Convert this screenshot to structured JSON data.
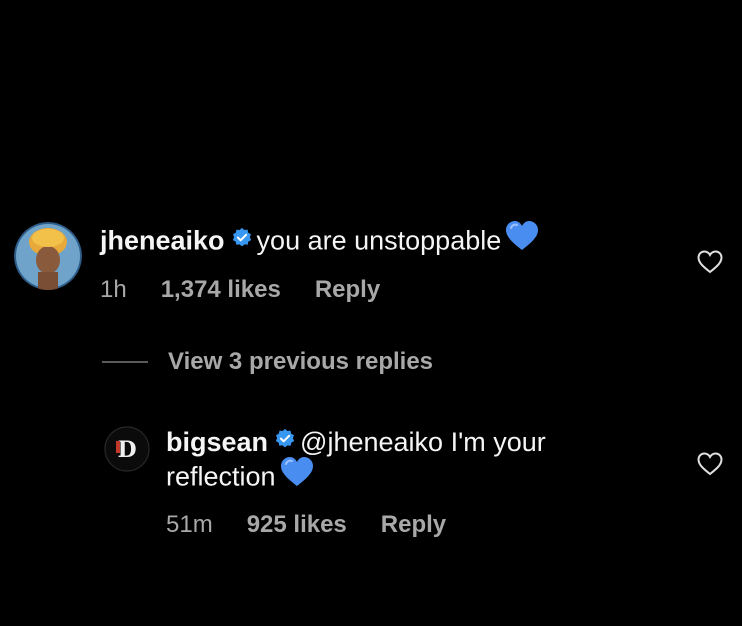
{
  "comment": {
    "username": "jheneaiko",
    "text": "you are unstoppable",
    "emoji": "blue-heart",
    "time": "1h",
    "likes": "1,374 likes",
    "reply": "Reply"
  },
  "view_replies": {
    "label": "View 3 previous replies"
  },
  "reply_comment": {
    "username": "bigsean",
    "mention": "@jheneaiko",
    "text_part1": "I'm your",
    "text_part2": "reflection",
    "emoji": "blue-heart",
    "time": "51m",
    "likes": "925 likes",
    "reply": "Reply"
  },
  "colors": {
    "background": "#000000",
    "text": "#f5f5f5",
    "muted": "#a8a8a8",
    "verified_badge": "#3897f0",
    "heart_emoji": "#4a8df0"
  }
}
